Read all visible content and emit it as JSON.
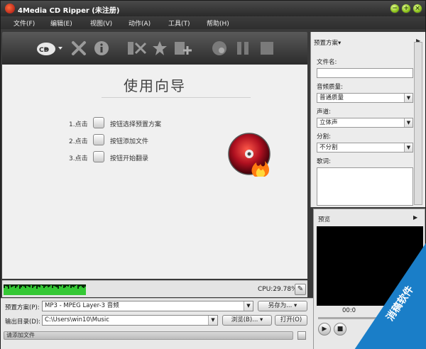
{
  "window": {
    "title": "4Media CD Ripper (未注册)"
  },
  "menu": [
    "文件(F)",
    "编辑(E)",
    "视图(V)",
    "动作(A)",
    "工具(T)",
    "帮助(H)"
  ],
  "wizard": {
    "title": "使用向导",
    "steps": [
      {
        "num": "1.点击",
        "text": "按钮选择预置方案"
      },
      {
        "num": "2.点击",
        "text": "按钮添加文件"
      },
      {
        "num": "3.点击",
        "text": "按钮开始翻录"
      }
    ]
  },
  "status": {
    "cpu": "CPU:29.78%"
  },
  "bottom": {
    "profile_label": "预置方案(P):",
    "profile_value": "MP3 - MPEG Layer-3 音频",
    "save_as": "另存为...",
    "output_label": "输出目录(D):",
    "output_value": "C:\\Users\\win10\\Music",
    "browse": "浏览(B)...",
    "open": "打开(O)",
    "progress_text": "请添加文件"
  },
  "right_panel": {
    "header": "预置方案▾",
    "filename_label": "文件名:",
    "filename_value": "",
    "quality_label": "音频质量:",
    "quality_value": "普通质量",
    "channel_label": "声道:",
    "channel_value": "立体声",
    "split_label": "分割:",
    "split_value": "不分割",
    "lyrics_label": "歌词:"
  },
  "preview": {
    "title": "预览",
    "time": "00:0"
  },
  "watermark": {
    "text": "消稿软件"
  },
  "colors": {
    "accent": "#1a7ec8",
    "visualizer": "#34c834"
  }
}
